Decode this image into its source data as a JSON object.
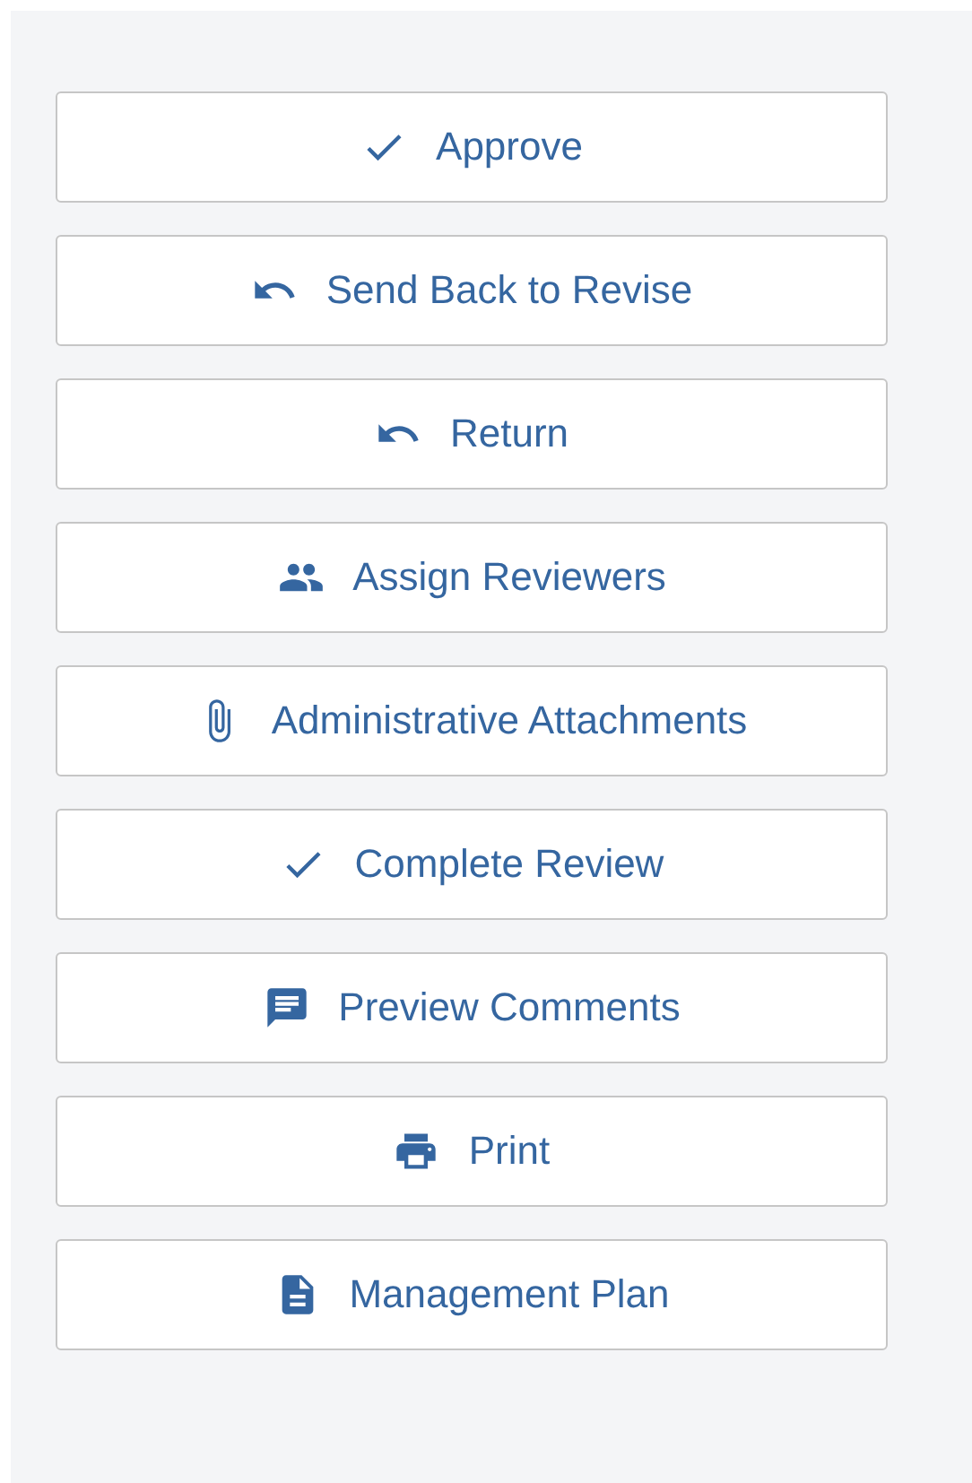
{
  "actions": [
    {
      "label": "Approve",
      "kind": "check"
    },
    {
      "label": "Send Back to Revise",
      "kind": "undo"
    },
    {
      "label": "Return",
      "kind": "undo"
    },
    {
      "label": "Assign Reviewers",
      "kind": "people"
    },
    {
      "label": "Administrative Attachments",
      "kind": "attach"
    },
    {
      "label": "Complete Review",
      "kind": "check"
    },
    {
      "label": "Preview Comments",
      "kind": "comment"
    },
    {
      "label": "Print",
      "kind": "print"
    },
    {
      "label": "Management Plan",
      "kind": "file"
    }
  ]
}
